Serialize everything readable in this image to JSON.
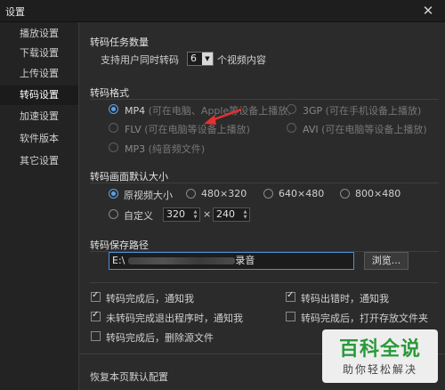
{
  "window": {
    "title": "设置"
  },
  "sidebar": {
    "items": [
      {
        "label": "播放设置"
      },
      {
        "label": "下载设置"
      },
      {
        "label": "上传设置"
      },
      {
        "label": "转码设置",
        "active": true
      },
      {
        "label": "加速设置"
      },
      {
        "label": "软件版本"
      },
      {
        "label": "其它设置"
      }
    ]
  },
  "tasks": {
    "title": "转码任务数量",
    "prefix": "支持用户同时转码",
    "value": "6",
    "suffix": "个视频内容"
  },
  "format": {
    "title": "转码格式",
    "options": [
      {
        "label": "MP4",
        "note": "(可在电脑、Apple等设备上播放)",
        "checked": true
      },
      {
        "label": "3GP",
        "note": "(可在手机设备上播放)",
        "checked": false
      },
      {
        "label": "FLV",
        "note": "(可在电脑等设备上播放)",
        "checked": false
      },
      {
        "label": "AVI",
        "note": "(可在电脑等设备上播放)",
        "checked": false
      },
      {
        "label": "MP3",
        "note": "(纯音频文件)",
        "checked": false
      }
    ]
  },
  "size": {
    "title": "转码画面默认大小",
    "options": [
      {
        "label": "原视频大小",
        "checked": true
      },
      {
        "label": "480×320",
        "checked": false
      },
      {
        "label": "640×480",
        "checked": false
      },
      {
        "label": "800×480",
        "checked": false
      }
    ],
    "custom_label": "自定义",
    "width": "320",
    "times": "×",
    "height": "240"
  },
  "path": {
    "title": "转码保存路径",
    "value_prefix": "E:\\",
    "value_suffix": "录音",
    "browse_label": "浏览..."
  },
  "options": [
    {
      "label": "转码完成后，通知我",
      "checked": true
    },
    {
      "label": "转码出错时，通知我",
      "checked": true
    },
    {
      "label": "未转码完成退出程序时，通知我",
      "checked": true
    },
    {
      "label": "转码完成后，打开存放文件夹",
      "checked": false
    },
    {
      "label": "转码完成后，删除源文件",
      "checked": false
    }
  ],
  "footer": {
    "restore_label": "恢复本页默认配置"
  },
  "watermark": {
    "title": "百科全说",
    "subtitle": "助你轻松解决"
  },
  "colors": {
    "accent": "#5aa0e8",
    "arrow": "#e53030",
    "watermark": "#2a9a3a"
  }
}
